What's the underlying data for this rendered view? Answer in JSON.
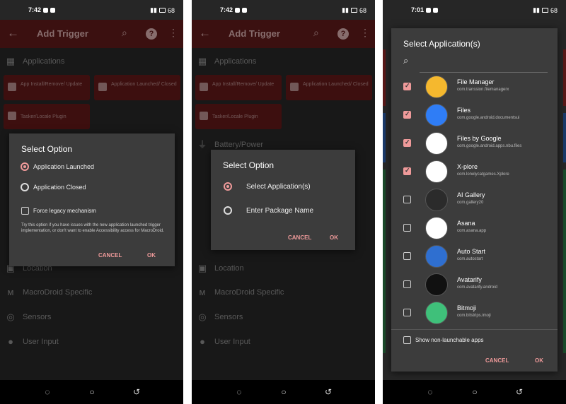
{
  "phone1": {
    "time": "7:42",
    "battery": "68",
    "toolbar": {
      "title": "Add Trigger"
    },
    "sections": {
      "applications": "Applications",
      "location": "Location",
      "macrodroid_specific": "MacroDroid Specific",
      "sensors": "Sensors",
      "user_input": "User Input"
    },
    "tiles": {
      "app_install": "App Install/Remove/ Update",
      "app_launched": "Application Launched/ Closed",
      "tasker_plugin": "Tasker/Locale Plugin"
    },
    "dialog": {
      "title": "Select Option",
      "option_launched": "Application Launched",
      "option_closed": "Application Closed",
      "legacy_label": "Force legacy mechanism",
      "help_text": "Try this option if you have issues with the new application launched trigger implementation, or don't want to enable Accessibility access for MacroDroid.",
      "cancel": "CANCEL",
      "ok": "OK"
    }
  },
  "phone2": {
    "time": "7:42",
    "battery": "68",
    "toolbar": {
      "title": "Add Trigger"
    },
    "sections": {
      "applications": "Applications",
      "battery_power": "Battery/Power",
      "location": "Location",
      "macrodroid_specific": "MacroDroid Specific",
      "sensors": "Sensors",
      "user_input": "User Input"
    },
    "tiles": {
      "app_install": "App Install/Remove/ Update",
      "app_launched": "Application Launched/ Closed",
      "tasker_plugin": "Tasker/Locale Plugin"
    },
    "dialog": {
      "title": "Select Option",
      "option_select_app": "Select Application(s)",
      "option_package": "Enter Package Name",
      "cancel": "CANCEL",
      "ok": "OK"
    }
  },
  "phone3": {
    "time": "7:01",
    "battery": "68",
    "dialog": {
      "title": "Select Application(s)",
      "apps": [
        {
          "name": "File Manager",
          "package": "com.transsion.filemanagerx",
          "checked": true,
          "icon": "file-manager-icon",
          "color": "#f5b82e"
        },
        {
          "name": "Files",
          "package": "com.google.android.documentsui",
          "checked": true,
          "icon": "files-icon",
          "color": "#2f7df6"
        },
        {
          "name": "Files by Google",
          "package": "com.google.android.apps.nbu.files",
          "checked": true,
          "icon": "files-by-google-icon",
          "color": "#ffffff"
        },
        {
          "name": "X-plore",
          "package": "com.lonelycatgames.Xplore",
          "checked": true,
          "icon": "xplore-icon",
          "color": "#ffffff"
        },
        {
          "name": "AI Gallery",
          "package": "com.gallery20",
          "checked": false,
          "icon": "ai-gallery-icon",
          "color": "#2b2b2b"
        },
        {
          "name": "Asana",
          "package": "com.asana.app",
          "checked": false,
          "icon": "asana-icon",
          "color": "#ffffff"
        },
        {
          "name": "Auto Start",
          "package": "com.autostart",
          "checked": false,
          "icon": "auto-start-icon",
          "color": "#2f6fd0"
        },
        {
          "name": "Avatarify",
          "package": "com.avatarify.android",
          "checked": false,
          "icon": "avatarify-icon",
          "color": "#111111"
        },
        {
          "name": "Bitmoji",
          "package": "com.bitstrips.imoji",
          "checked": false,
          "icon": "bitmoji-icon",
          "color": "#3fc07a"
        }
      ],
      "show_nonlaunchable": "Show non-launchable apps",
      "cancel": "CANCEL",
      "ok": "OK"
    }
  },
  "colors": {
    "accent": "#ef9a9a",
    "toolbar": "#5b1a1a",
    "tile": "#5e1818"
  }
}
